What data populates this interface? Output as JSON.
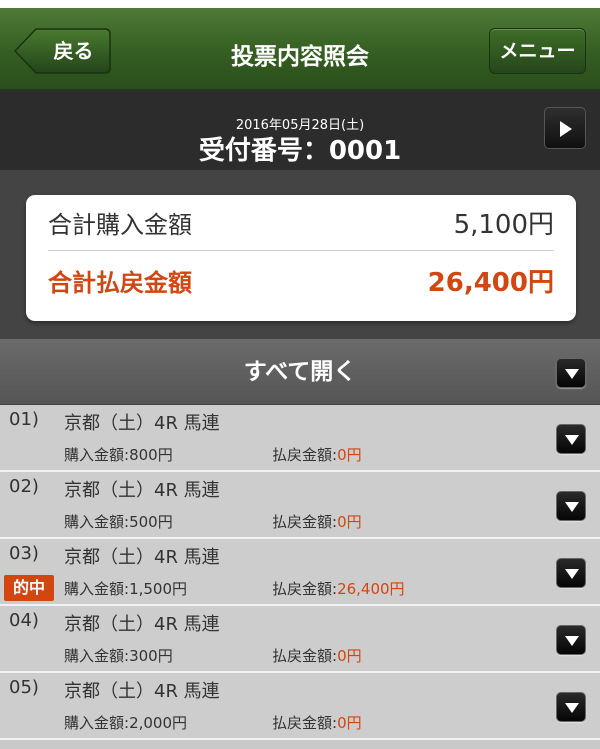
{
  "header": {
    "back_label": "戻る",
    "title": "投票内容照会",
    "menu_label": "メニュー"
  },
  "receipt": {
    "date": "2016年05月28日(土)",
    "number": "受付番号：0001"
  },
  "summary": {
    "purchase_label": "合計購入金額",
    "purchase_value": "5,100円",
    "payout_label": "合計払戻金額",
    "payout_value": "26,400円"
  },
  "expand_all_label": "すべて開く",
  "labels": {
    "purchase": "購入金額:",
    "payout": "払戻金額:",
    "hit": "的中"
  },
  "bets": [
    {
      "index": "01)",
      "race": "京都（土）4R 馬連",
      "purchase": "800円",
      "payout": "0円",
      "hit": false
    },
    {
      "index": "02)",
      "race": "京都（土）4R 馬連",
      "purchase": "500円",
      "payout": "0円",
      "hit": false
    },
    {
      "index": "03)",
      "race": "京都（土）4R 馬連",
      "purchase": "1,500円",
      "payout": "26,400円",
      "hit": true
    },
    {
      "index": "04)",
      "race": "京都（土）4R 馬連",
      "purchase": "300円",
      "payout": "0円",
      "hit": false
    },
    {
      "index": "05)",
      "race": "京都（土）4R 馬連",
      "purchase": "2,000円",
      "payout": "0円",
      "hit": false
    }
  ],
  "colors": {
    "header_green": "#355e22",
    "accent_red": "#d24612"
  }
}
